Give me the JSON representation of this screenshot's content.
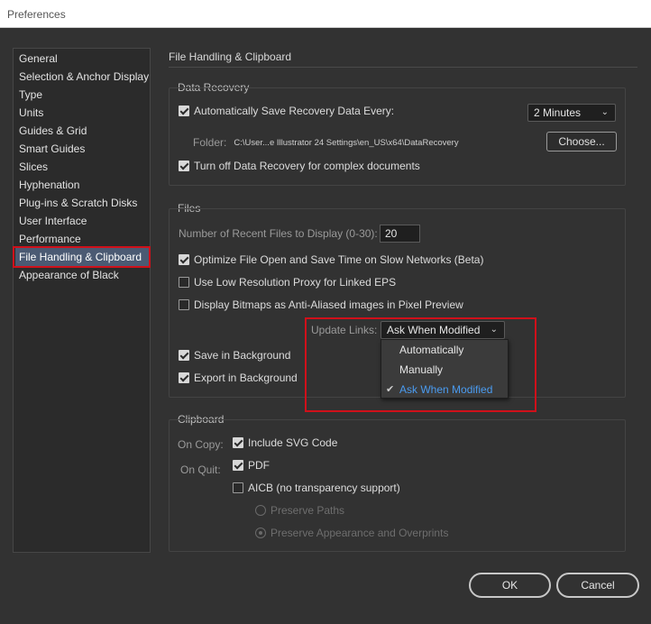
{
  "window": {
    "title": "Preferences"
  },
  "sidebar": {
    "items": [
      {
        "label": "General"
      },
      {
        "label": "Selection & Anchor Display"
      },
      {
        "label": "Type"
      },
      {
        "label": "Units"
      },
      {
        "label": "Guides & Grid"
      },
      {
        "label": "Smart Guides"
      },
      {
        "label": "Slices"
      },
      {
        "label": "Hyphenation"
      },
      {
        "label": "Plug-ins & Scratch Disks"
      },
      {
        "label": "User Interface"
      },
      {
        "label": "Performance"
      },
      {
        "label": "File Handling & Clipboard",
        "selected": true
      },
      {
        "label": "Appearance of Black"
      }
    ]
  },
  "page": {
    "title": "File Handling & Clipboard"
  },
  "data_recovery": {
    "label": "Data Recovery",
    "auto_save_label": "Automatically Save Recovery Data Every:",
    "auto_save_checked": true,
    "interval_value": "2 Minutes",
    "folder_label": "Folder:",
    "folder_path": "C:\\User...e Illustrator 24 Settings\\en_US\\x64\\DataRecovery",
    "choose_button": "Choose...",
    "turn_off_label": "Turn off Data Recovery for complex documents",
    "turn_off_checked": true
  },
  "files": {
    "label": "Files",
    "recent_label": "Number of Recent Files to Display (0-30):",
    "recent_value": "20",
    "optimize_label": "Optimize File Open and Save Time on Slow Networks (Beta)",
    "optimize_checked": true,
    "low_res_label": "Use Low Resolution Proxy for Linked EPS",
    "low_res_checked": false,
    "bitmaps_label": "Display Bitmaps as Anti-Aliased images in Pixel Preview",
    "bitmaps_checked": false,
    "update_links_label": "Update Links:",
    "update_links_value": "Ask When Modified",
    "update_links_options": [
      "Automatically",
      "Manually",
      "Ask When Modified"
    ],
    "save_bg_label": "Save in Background",
    "save_bg_checked": true,
    "export_bg_label": "Export in Background",
    "export_bg_checked": true
  },
  "clipboard": {
    "label": "Clipboard",
    "on_copy_label": "On Copy:",
    "include_svg_label": "Include SVG Code",
    "include_svg_checked": true,
    "on_quit_label": "On Quit:",
    "pdf_label": "PDF",
    "pdf_checked": true,
    "aicb_label": "AICB (no transparency support)",
    "aicb_checked": false,
    "preserve_paths_label": "Preserve Paths",
    "preserve_appearance_label": "Preserve Appearance and Overprints"
  },
  "buttons": {
    "ok": "OK",
    "cancel": "Cancel"
  },
  "colors": {
    "highlight": "#d0101a",
    "selection": "#4b5a73",
    "active_option": "#4a9bf0"
  }
}
